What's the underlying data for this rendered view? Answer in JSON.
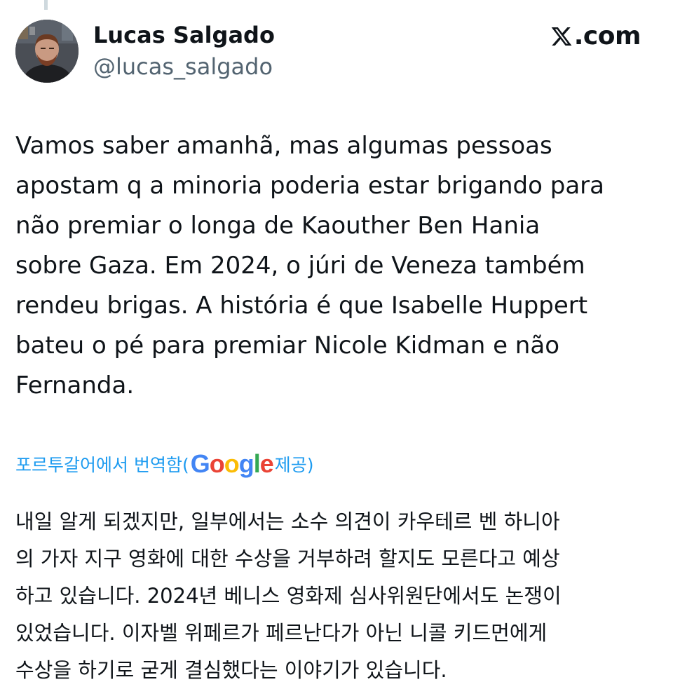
{
  "tweet": {
    "author": {
      "display_name": "Lucas Salgado",
      "handle": "@lucas_salgado"
    },
    "brand": {
      "text": ".com",
      "icon": "x-logo-icon"
    },
    "text": "Vamos saber amanhã, mas algumas pessoas\napostam q a minoria poderia estar brigando para\nnão premiar o longa de Kaouther Ben Hania\nsobre Gaza. Em 2024, o júri de Veneza também\nrendeu brigas. A história é que Isabelle Huppert\nbateu o pé para premiar Nicole Kidman e não\nFernanda.",
    "translation": {
      "label_prefix": "포르투갈어에서 번역함(",
      "provider_letters": [
        "G",
        "o",
        "o",
        "g",
        "l",
        "e"
      ],
      "label_suffix": " 제공)",
      "text": "내일 알게 되겠지만, 일부에서는 소수 의견이 카우테르 벤 하니아\n의 가자 지구 영화에 대한 수상을 거부하려 할지도 모른다고 예상\n하고 있습니다. 2024년 베니스 영화제 심사위원단에서도 논쟁이\n있었습니다. 이자벨 위페르가 페르난다가 아닌 니콜 키드먼에게\n수상을 하기로 굳게 결심했다는 이야기가 있습니다."
    }
  },
  "colors": {
    "text": "#0f1419",
    "secondary": "#536471",
    "link": "#1d9bf0",
    "thread_line": "#cfd9de"
  }
}
